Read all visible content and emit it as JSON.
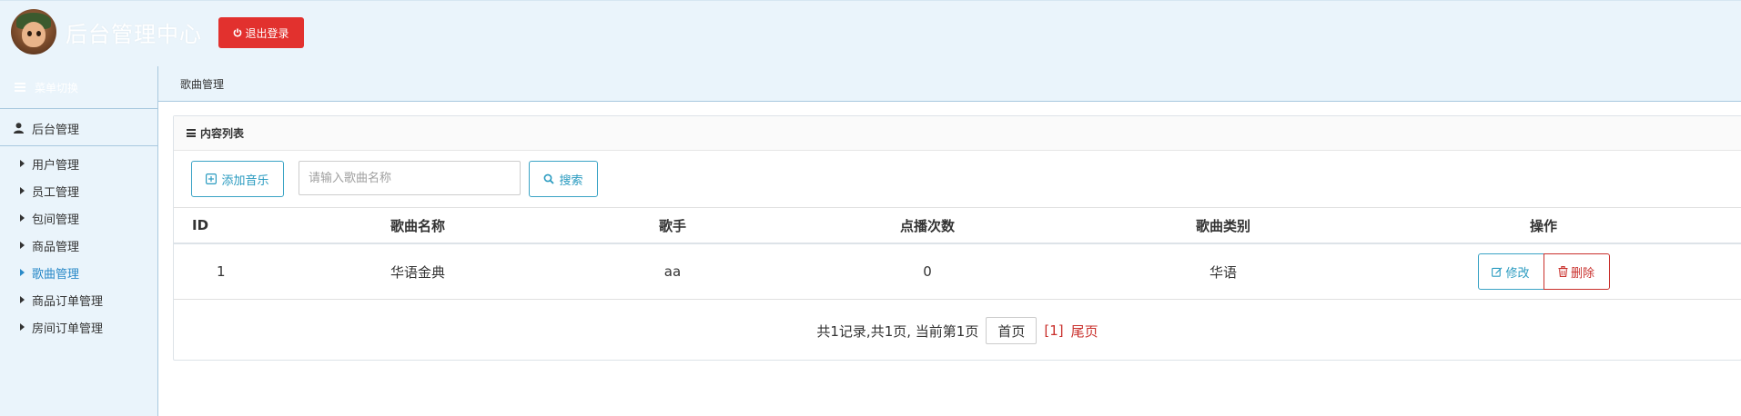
{
  "header": {
    "title": "后台管理中心",
    "logout_label": "退出登录"
  },
  "sidebar": {
    "toggle_label": "菜单切换",
    "group_label": "后台管理",
    "items": [
      {
        "label": "用户管理",
        "active": false
      },
      {
        "label": "员工管理",
        "active": false
      },
      {
        "label": "包间管理",
        "active": false
      },
      {
        "label": "商品管理",
        "active": false
      },
      {
        "label": "歌曲管理",
        "active": true
      },
      {
        "label": "商品订单管理",
        "active": false
      },
      {
        "label": "房间订单管理",
        "active": false
      }
    ]
  },
  "breadcrumb": "歌曲管理",
  "panel": {
    "title": "内容列表",
    "add_label": "添加音乐",
    "search_placeholder": "请输入歌曲名称",
    "search_label": "搜索"
  },
  "table": {
    "columns": [
      "ID",
      "歌曲名称",
      "歌手",
      "点播次数",
      "歌曲类别",
      "操作"
    ],
    "rows": [
      {
        "id": "1",
        "name": "华语金典",
        "singer": "aa",
        "plays": "0",
        "category": "华语"
      }
    ],
    "edit_label": "修改",
    "delete_label": "删除"
  },
  "pager": {
    "summary": "共1记录,共1页, 当前第1页",
    "first_label": "首页",
    "current": "[1]",
    "last_label": "尾页"
  },
  "colors": {
    "logout_bg": "#e2312e",
    "accent": "#2a9bc0",
    "danger": "#c9302c",
    "background": "#eaf4fb"
  }
}
